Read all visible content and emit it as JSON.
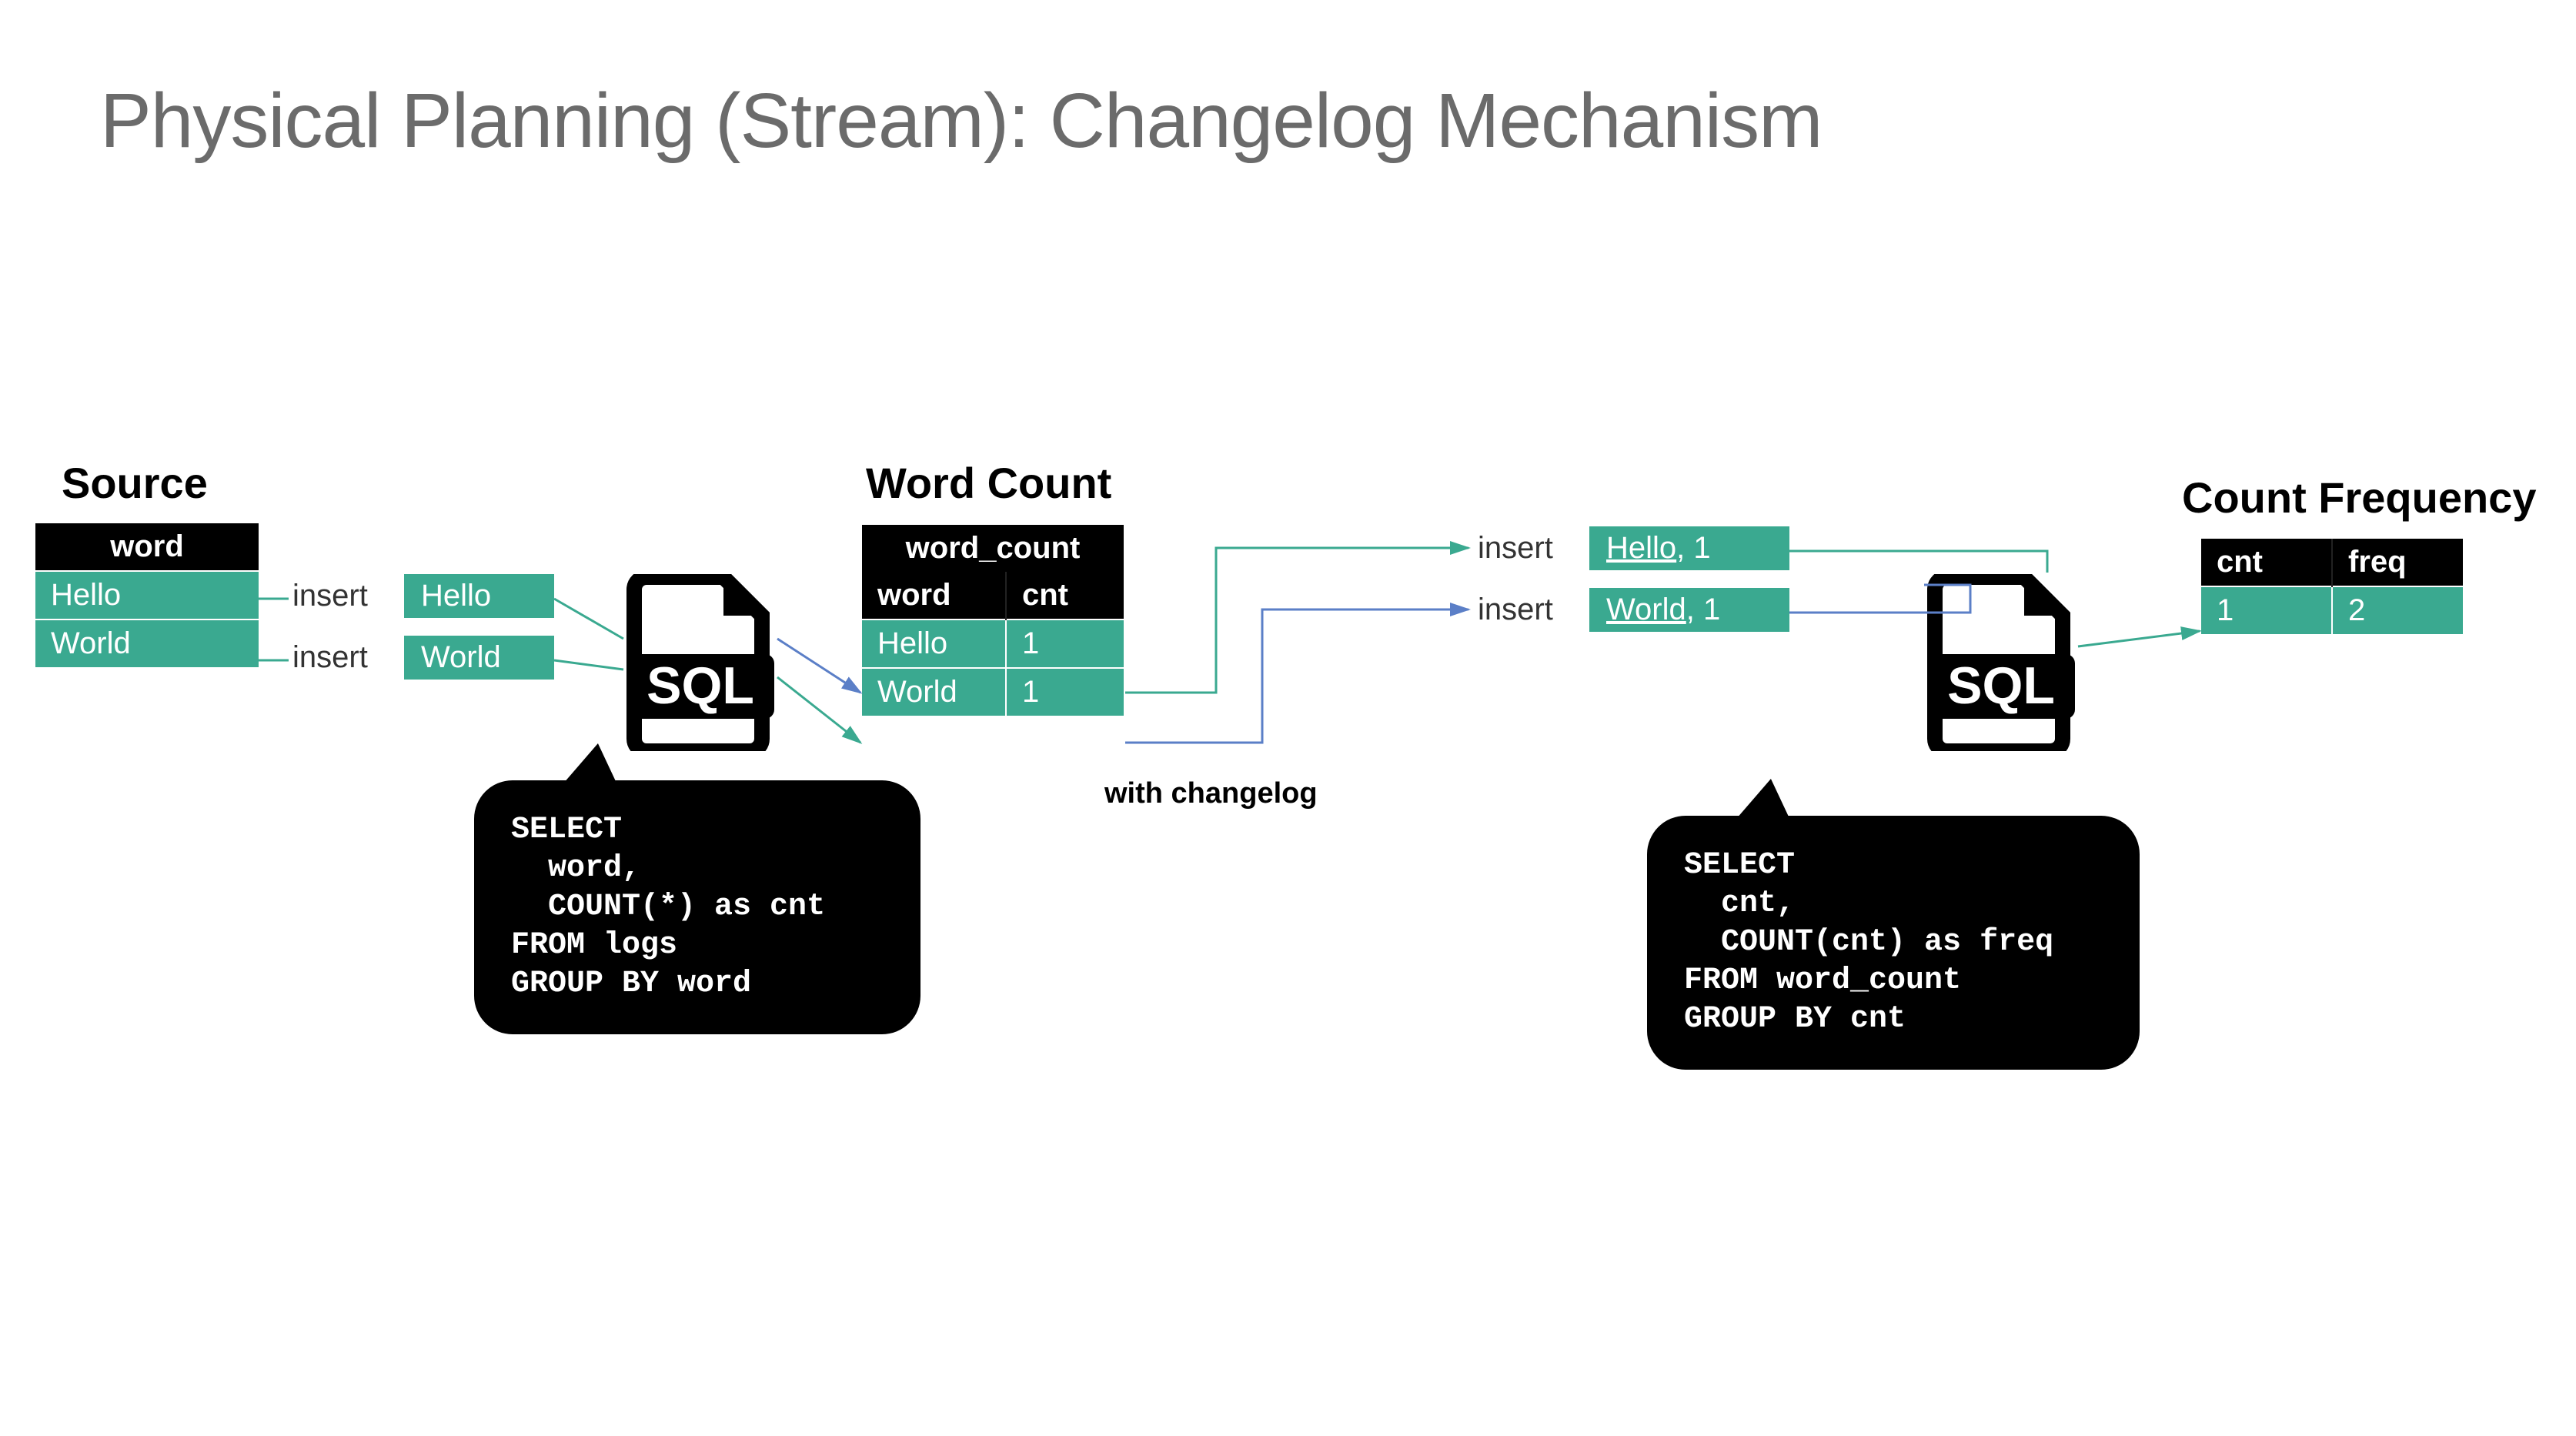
{
  "title": "Physical Planning (Stream): Changelog Mechanism",
  "source": {
    "heading": "Source",
    "header": "word",
    "rows": [
      "Hello",
      "World"
    ]
  },
  "events1": [
    {
      "op": "insert",
      "value": "Hello"
    },
    {
      "op": "insert",
      "value": "World"
    }
  ],
  "sql_label": "SQL",
  "sql1": "SELECT\n  word,\n  COUNT(*) as cnt\nFROM logs\nGROUP BY word",
  "wordcount": {
    "heading": "Word Count",
    "caption": "word_count",
    "cols": [
      "word",
      "cnt"
    ],
    "rows": [
      [
        "Hello",
        "1"
      ],
      [
        "World",
        "1"
      ]
    ]
  },
  "changelog_label": "with changelog",
  "events2": [
    {
      "op": "insert",
      "key": "Hello",
      "val": "1"
    },
    {
      "op": "insert",
      "key": "World",
      "val": "1"
    }
  ],
  "sql2": "SELECT\n  cnt,\n  COUNT(cnt) as freq\nFROM word_count\nGROUP BY cnt",
  "countfreq": {
    "heading": "Count Frequency",
    "cols": [
      "cnt",
      "freq"
    ],
    "rows": [
      [
        "1",
        "2"
      ]
    ]
  }
}
